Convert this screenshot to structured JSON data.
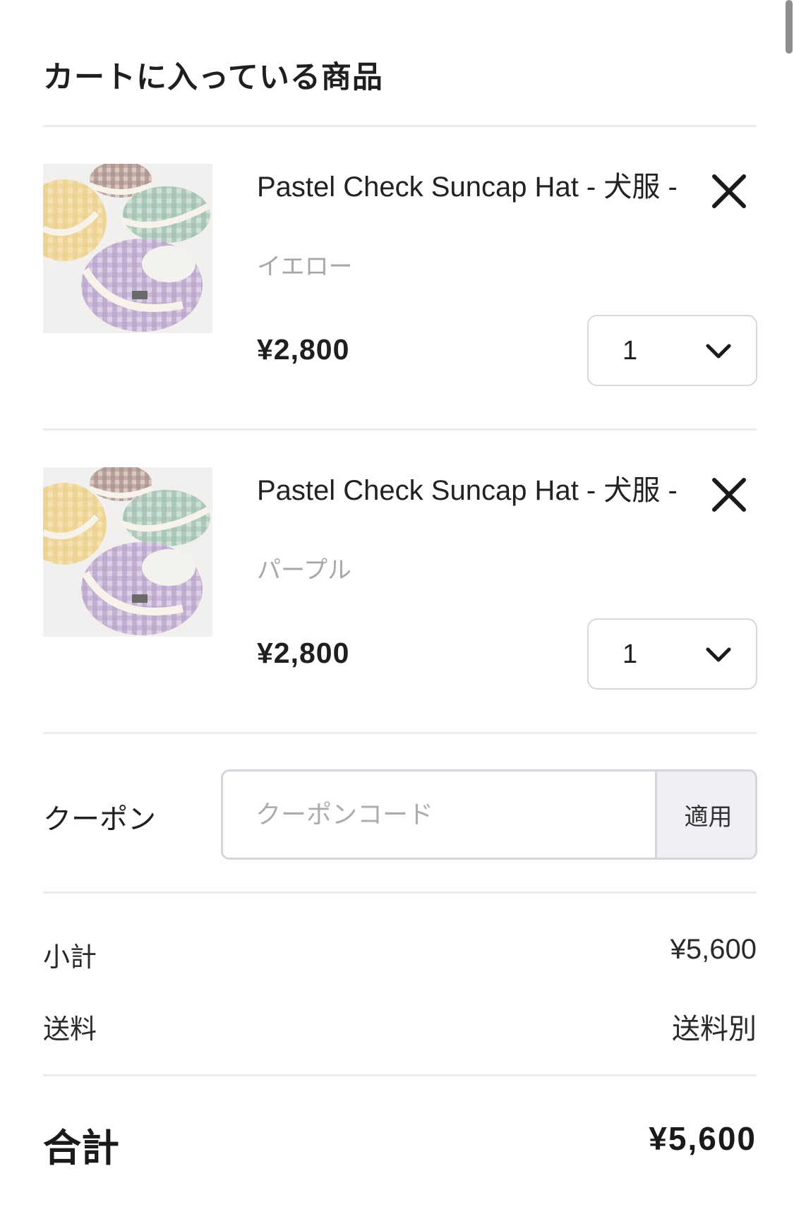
{
  "cart": {
    "title": "カートに入っている商品",
    "items": [
      {
        "name": "Pastel Check Suncap Hat - 犬服 -",
        "variant": "イエロー",
        "price": "¥2,800",
        "quantity": "1",
        "image": "product-photo-pastel-check-suncaps"
      },
      {
        "name": "Pastel Check Suncap Hat - 犬服 -",
        "variant": "パープル",
        "price": "¥2,800",
        "quantity": "1",
        "image": "product-photo-pastel-check-suncaps"
      }
    ]
  },
  "coupon": {
    "label": "クーポン",
    "placeholder": "クーポンコード",
    "value": "",
    "apply_label": "適用"
  },
  "summary": {
    "subtotal_label": "小計",
    "subtotal_value": "¥5,600",
    "shipping_label": "送料",
    "shipping_value": "送料別",
    "total_label": "合計",
    "total_value": "¥5,600"
  },
  "icons": {
    "remove": "close-icon",
    "quantity_dropdown": "chevron-down-icon"
  },
  "colors": {
    "text": "#1f1f1f",
    "muted_text": "#a7a7a7",
    "divider": "#ececec",
    "border": "#d8d8d8",
    "apply_button_bg": "#eef0f3"
  }
}
